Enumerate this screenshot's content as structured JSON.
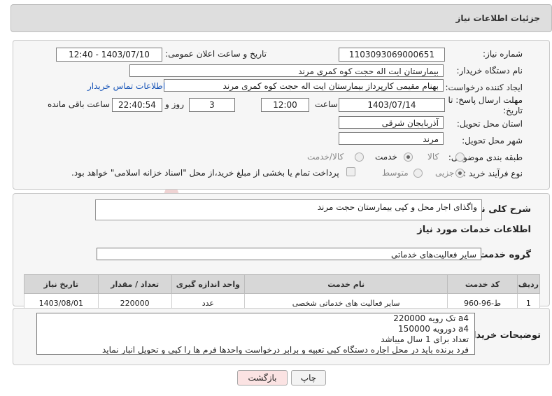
{
  "header": {
    "title": "جزئیات اطلاعات نیاز"
  },
  "form": {
    "need_number": {
      "label": "شماره نیاز:",
      "value": "1103093069000651"
    },
    "announce": {
      "label": "تاریخ و ساعت اعلان عمومی:",
      "value": "1403/07/10 - 12:40"
    },
    "buyer_org": {
      "label": "نام دستگاه خریدار:",
      "value": "بیمارستان ایت اله حجت کوه کمری مرند"
    },
    "creator": {
      "label": "ایجاد کننده درخواست:",
      "value": "بهنام مقیمی کارپرداز بیمارستان ایت اله حجت کوه کمری مرند",
      "contact_link": "اطلاعات تماس خریدار"
    },
    "deadline": {
      "label": "مهلت ارسال پاسخ: تا تاریخ:",
      "date": "1403/07/14",
      "time_label": "ساعت",
      "time": "12:00",
      "days": "3",
      "days_label": "روز و",
      "remaining": "22:40:54",
      "remaining_label": "ساعت باقی مانده"
    },
    "province": {
      "label": "استان محل تحویل:",
      "value": "آذربایجان شرقی"
    },
    "city": {
      "label": "شهر محل تحویل:",
      "value": "مرند"
    },
    "category": {
      "label": "طبقه بندی موضوعی:",
      "options": [
        "کالا",
        "خدمت",
        "کالا/خدمت"
      ],
      "selected": "خدمت"
    },
    "purchase_type": {
      "label": "نوع فرآیند خرید :",
      "options": [
        "جزیی",
        "متوسط"
      ],
      "selected": "جزیی",
      "payment_note": "پرداخت تمام یا بخشی از مبلغ خرید،از محل \"اسناد خزانه اسلامی\" خواهد بود."
    }
  },
  "summary": {
    "label": "شرح کلی نیاز:",
    "value": "واگذای اجار محل و کپی بیمارستان حجت مرند"
  },
  "services_title": "اطلاعات خدمات مورد نیاز",
  "service_group": {
    "label": "گروه خدمت:",
    "value": "سایر فعالیت‌های خدماتی"
  },
  "table": {
    "headers": [
      "ردیف",
      "کد خدمت",
      "نام خدمت",
      "واحد اندازه گیری",
      "تعداد / مقدار",
      "تاریخ نیاز"
    ],
    "rows": [
      [
        "1",
        "ط-96-960",
        "سایر فعالیت های خدماتی شخصی",
        "عدد",
        "220000",
        "1403/08/01"
      ]
    ]
  },
  "buyer_notes": {
    "label": "توضیحات خریدار:",
    "lines": [
      "a4 تک رویه 220000",
      "a4 دورویه 150000",
      "تعداد برای 1 سال میباشد",
      "فرد برنده باید در محل اجاره دستگاه کپی تعبیه و برابر درخواست واحدها فرم ها را کپی و تحویل انبار نماید"
    ]
  },
  "buttons": {
    "print": "چاپ",
    "back": "بازگشت"
  },
  "watermark": {
    "text": "AriaTender.neT"
  },
  "colors": {
    "accent_link": "#1a56b8",
    "back_button_bg": "#fbe3e3",
    "watermark": "#e7b9b9"
  }
}
